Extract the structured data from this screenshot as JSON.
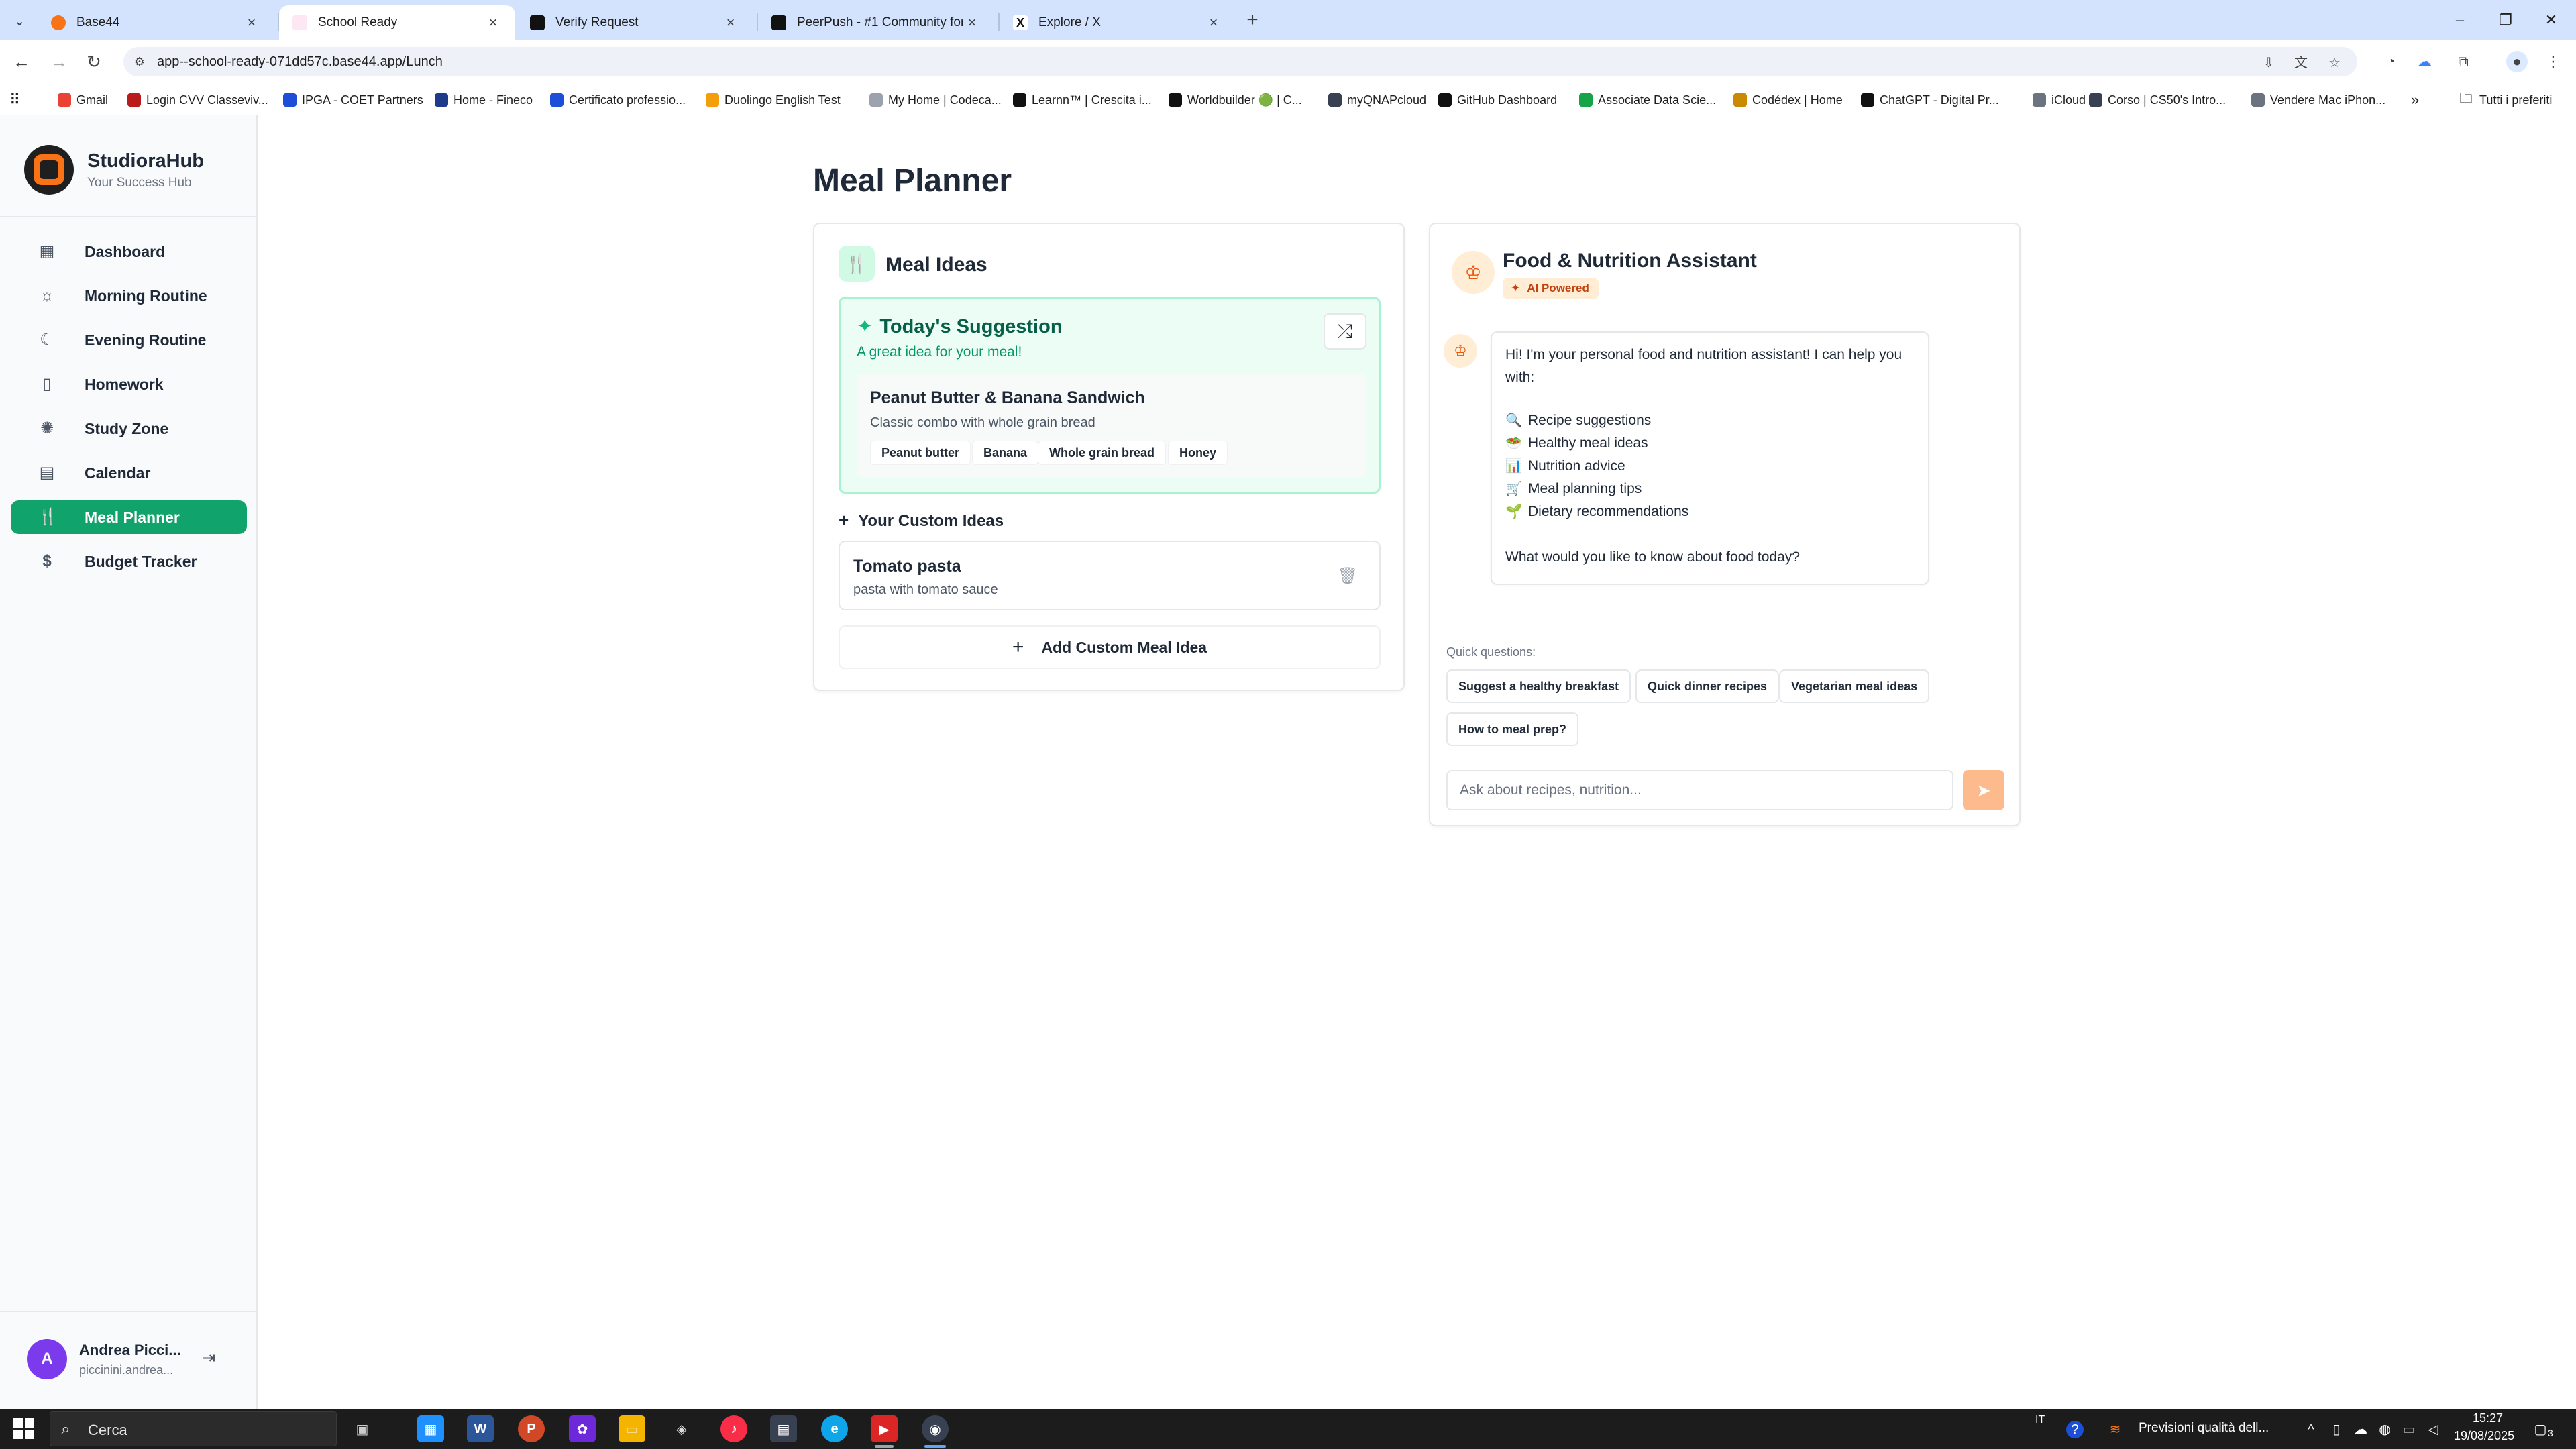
{
  "browser": {
    "tabs": [
      {
        "title": "Base44",
        "color": "#f97316"
      },
      {
        "title": "School Ready",
        "color": "#ec4899"
      },
      {
        "title": "Verify Request",
        "color": "#111111"
      },
      {
        "title": "PeerPush - #1 Community for I",
        "color": "#111111"
      },
      {
        "title": "Explore / X",
        "color": "#111111"
      }
    ],
    "url": "app--school-ready-071dd57c.base44.app/Lunch",
    "bookmarks": [
      {
        "label": "Gmail",
        "color": "#ea4335"
      },
      {
        "label": "Login CVV Classeviv...",
        "color": "#b91c1c"
      },
      {
        "label": "IPGA - COET Partners",
        "color": "#1d4ed8"
      },
      {
        "label": "Home - Fineco",
        "color": "#1e3a8a"
      },
      {
        "label": "Certificato professio...",
        "color": "#1d4ed8"
      },
      {
        "label": "Duolingo English Test",
        "color": "#f59e0b"
      },
      {
        "label": "My Home | Codeca...",
        "color": "#9ca3af"
      },
      {
        "label": "Learnn™ | Crescita i...",
        "color": "#111111"
      },
      {
        "label": "Worldbuilder 🟢 | C...",
        "color": "#111111"
      },
      {
        "label": "myQNAPcloud",
        "color": "#374151"
      },
      {
        "label": "GitHub Dashboard",
        "color": "#111111"
      },
      {
        "label": "Associate Data Scie...",
        "color": "#16a34a"
      },
      {
        "label": "Codédex | Home",
        "color": "#ca8a04"
      },
      {
        "label": "ChatGPT - Digital Pr...",
        "color": "#111111"
      },
      {
        "label": "iCloud",
        "color": "#6b7280"
      },
      {
        "label": "Corso | CS50's Intro...",
        "color": "#374151"
      },
      {
        "label": "Vendere Mac iPhon...",
        "color": "#6b7280"
      }
    ],
    "bookmarks_folder": "Tutti i preferiti"
  },
  "app": {
    "brand_name": "StudioraHub",
    "brand_tagline": "Your Success Hub",
    "brand_color": "#f97316",
    "accent_color": "#10a36b",
    "nav": [
      {
        "label": "Dashboard",
        "icon": "grid-icon"
      },
      {
        "label": "Morning Routine",
        "icon": "sun-icon"
      },
      {
        "label": "Evening Routine",
        "icon": "moon-icon"
      },
      {
        "label": "Homework",
        "icon": "book-icon"
      },
      {
        "label": "Study Zone",
        "icon": "brain-icon"
      },
      {
        "label": "Calendar",
        "icon": "calendar-icon"
      },
      {
        "label": "Meal Planner",
        "icon": "utensils-icon",
        "active": true
      },
      {
        "label": "Budget Tracker",
        "icon": "dollar-icon"
      }
    ],
    "user": {
      "initial": "A",
      "name": "Andrea Picci...",
      "email": "piccinini.andrea..."
    }
  },
  "main": {
    "page_title": "Meal Planner",
    "meal_ideas": {
      "title": "Meal Ideas",
      "suggestion": {
        "title": "Today's Suggestion",
        "subtitle": "A great idea for your meal!",
        "meal_name": "Peanut Butter & Banana Sandwich",
        "meal_desc": "Classic combo with whole grain bread",
        "ingredients": [
          "Peanut butter",
          "Banana",
          "Whole grain bread",
          "Honey"
        ]
      },
      "custom_header": "Your Custom Ideas",
      "custom_items": [
        {
          "name": "Tomato pasta",
          "desc": "pasta with tomato sauce"
        }
      ],
      "add_button": "Add Custom Meal Idea"
    },
    "assistant": {
      "title": "Food & Nutrition Assistant",
      "badge": "AI Powered",
      "intro": "Hi! I'm your personal food and nutrition assistant! I can help you with:",
      "capabilities": [
        {
          "emoji": "🔍",
          "text": "Recipe suggestions"
        },
        {
          "emoji": "🥗",
          "text": "Healthy meal ideas"
        },
        {
          "emoji": "📊",
          "text": "Nutrition advice"
        },
        {
          "emoji": "🛒",
          "text": "Meal planning tips"
        },
        {
          "emoji": "🌱",
          "text": "Dietary recommendations"
        }
      ],
      "closing": "What would you like to know about food today?",
      "quick_label": "Quick questions:",
      "quick_questions": [
        "Suggest a healthy breakfast",
        "Quick dinner recipes",
        "Vegetarian meal ideas",
        "How to meal prep?"
      ],
      "input_placeholder": "Ask about recipes, nutrition..."
    }
  },
  "taskbar": {
    "search_text": "Cerca",
    "lang": "IT",
    "weather": "Previsioni qualità dell...",
    "time": "15:27",
    "date": "19/08/2025",
    "notif_count": "3"
  }
}
